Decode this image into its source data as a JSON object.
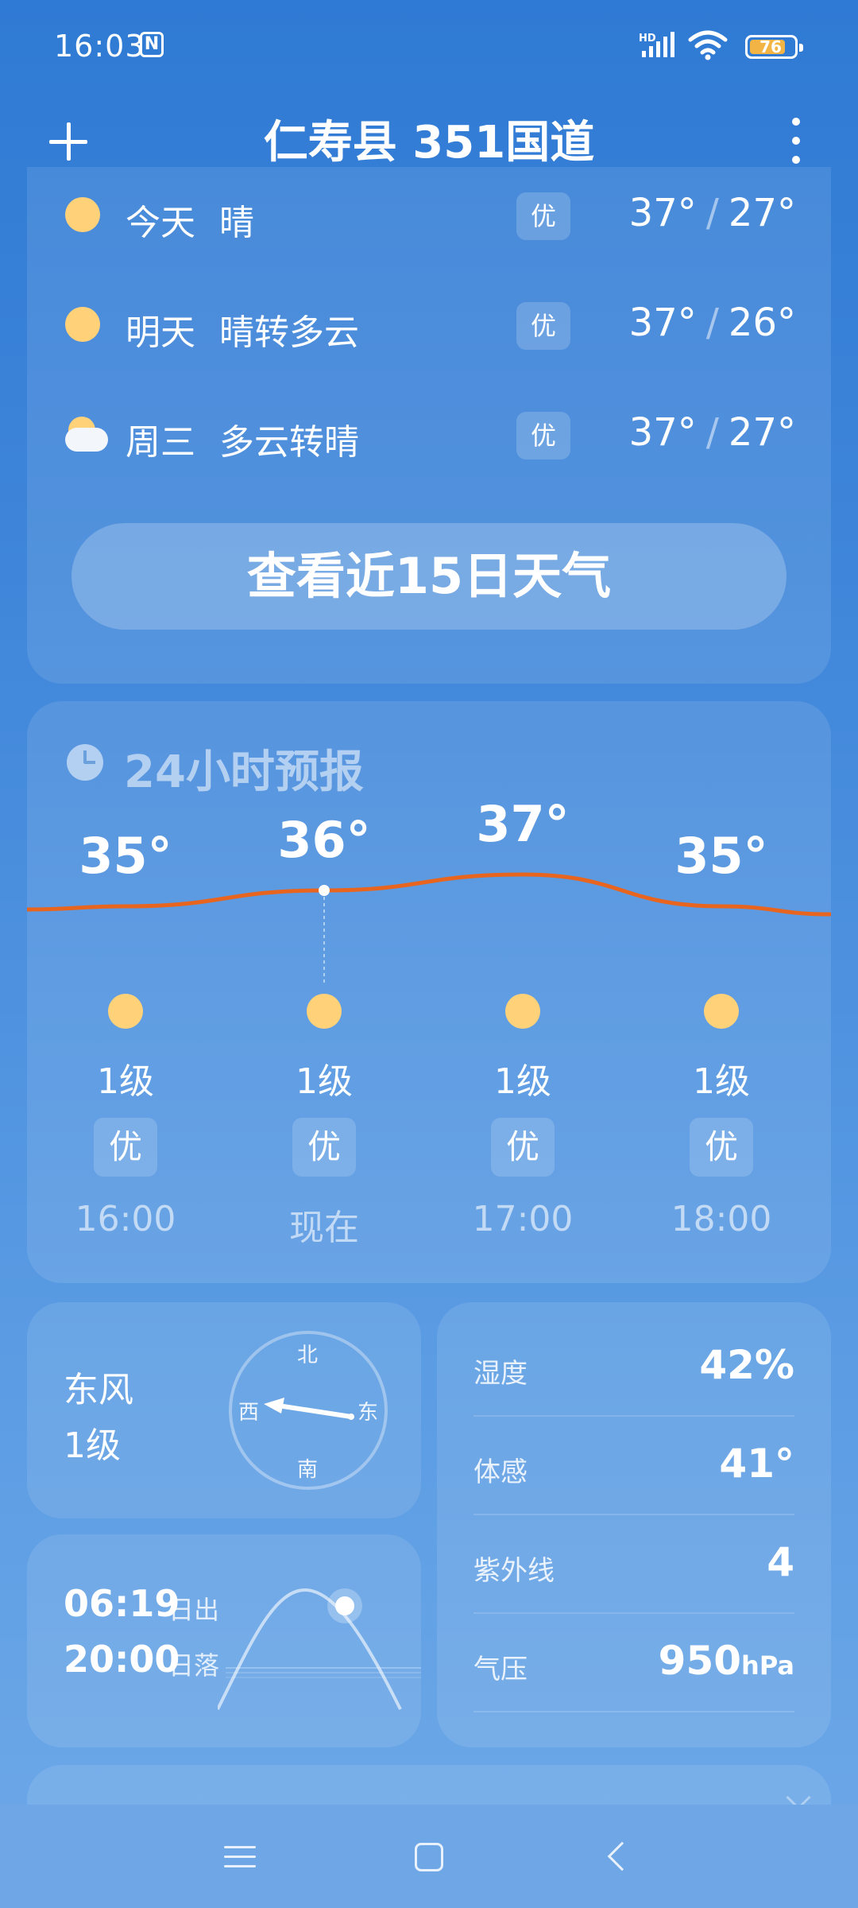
{
  "status_bar": {
    "time": "16:03",
    "nfc_glyph": "N",
    "network_label": "HD",
    "battery_level": "76"
  },
  "header": {
    "title": "仁寿县 351国道"
  },
  "daily_forecast": [
    {
      "day": "今天",
      "condition": "晴",
      "icon": "sun-icon",
      "aqi": "优",
      "high": "37°",
      "low": "27°"
    },
    {
      "day": "明天",
      "condition": "晴转多云",
      "icon": "sun-icon",
      "aqi": "优",
      "high": "37°",
      "low": "26°"
    },
    {
      "day": "周三",
      "condition": "多云转晴",
      "icon": "cloud-sun-icon",
      "aqi": "优",
      "high": "37°",
      "low": "27°"
    }
  ],
  "forecast_button": "查看近15日天气",
  "hourly": {
    "title": "24小时预报",
    "items": [
      {
        "temp": "35°",
        "temp_value": 35,
        "wind": "1级",
        "aqi": "优",
        "time": "16:00",
        "icon": "sun-icon"
      },
      {
        "temp": "36°",
        "temp_value": 36,
        "wind": "1级",
        "aqi": "优",
        "time": "现在",
        "icon": "sun-icon"
      },
      {
        "temp": "37°",
        "temp_value": 37,
        "wind": "1级",
        "aqi": "优",
        "time": "17:00",
        "icon": "sun-icon"
      },
      {
        "temp": "35°",
        "temp_value": 35,
        "wind": "1级",
        "aqi": "优",
        "time": "18:00",
        "icon": "sun-icon"
      }
    ],
    "current_index": 1,
    "line_color": "#e8651f"
  },
  "wind": {
    "direction": "东风",
    "level": "1级",
    "compass": {
      "north": "北",
      "south": "南",
      "east": "东",
      "west": "西"
    }
  },
  "sun": {
    "sunrise": "06:19",
    "sunrise_label": "日出",
    "sunset": "20:00",
    "sunset_label": "日落"
  },
  "details": [
    {
      "label": "湿度",
      "value": "42%",
      "unit": ""
    },
    {
      "label": "体感",
      "value": "41°",
      "unit": ""
    },
    {
      "label": "紫外线",
      "value": "4",
      "unit": ""
    },
    {
      "label": "气压",
      "value": "950",
      "unit": "hPa"
    }
  ],
  "colors": {
    "background_top": "#2f7ad4",
    "background_bottom": "#6ea9e8",
    "sun": "#ffd27a",
    "battery": "#f2b445"
  }
}
